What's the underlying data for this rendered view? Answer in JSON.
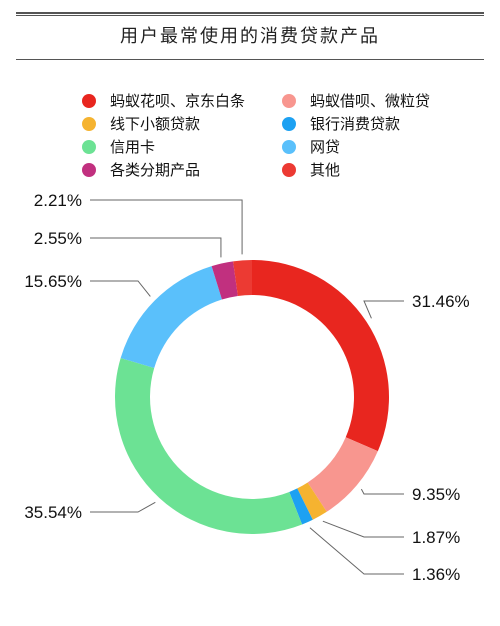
{
  "chart_data": {
    "type": "pie",
    "variant": "donut",
    "title": "用户最常使用的消费贷款产品",
    "categories": [
      "蚂蚁花呗、京东白条",
      "蚂蚁借呗、微粒贷",
      "线下小额贷款",
      "银行消费贷款",
      "信用卡",
      "网贷",
      "各类分期产品",
      "其他"
    ],
    "values": [
      31.46,
      9.35,
      1.87,
      1.36,
      35.54,
      15.65,
      2.55,
      2.21
    ],
    "labels": [
      "31.46%",
      "9.35%",
      "1.87%",
      "1.36%",
      "35.54%",
      "15.65%",
      "2.55%",
      "2.21%"
    ],
    "colors": [
      "#e8261f",
      "#f8968f",
      "#f5b330",
      "#1da1f2",
      "#6ce294",
      "#5ac0fb",
      "#c1307f",
      "#ec3a33"
    ],
    "legend_order": [
      0,
      1,
      2,
      3,
      4,
      5,
      6,
      7
    ],
    "legend_position": "top",
    "start": "12 o'clock, clockwise"
  }
}
